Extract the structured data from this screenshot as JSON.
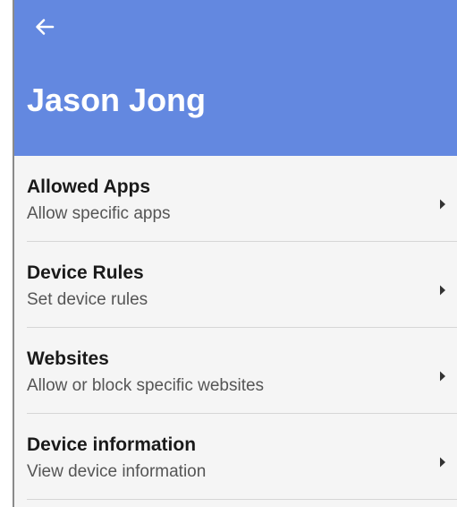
{
  "header": {
    "title": "Jason Jong",
    "back_icon": "arrow-left-icon",
    "background_color": "#6388e0"
  },
  "menu": {
    "items": [
      {
        "title": "Allowed Apps",
        "subtitle": "Allow specific apps",
        "icon": "chevron-right-icon"
      },
      {
        "title": "Device Rules",
        "subtitle": "Set device rules",
        "icon": "chevron-right-icon"
      },
      {
        "title": "Websites",
        "subtitle": "Allow or block specific websites",
        "icon": "chevron-right-icon"
      },
      {
        "title": "Device information",
        "subtitle": "View device information",
        "icon": "chevron-right-icon"
      }
    ]
  }
}
